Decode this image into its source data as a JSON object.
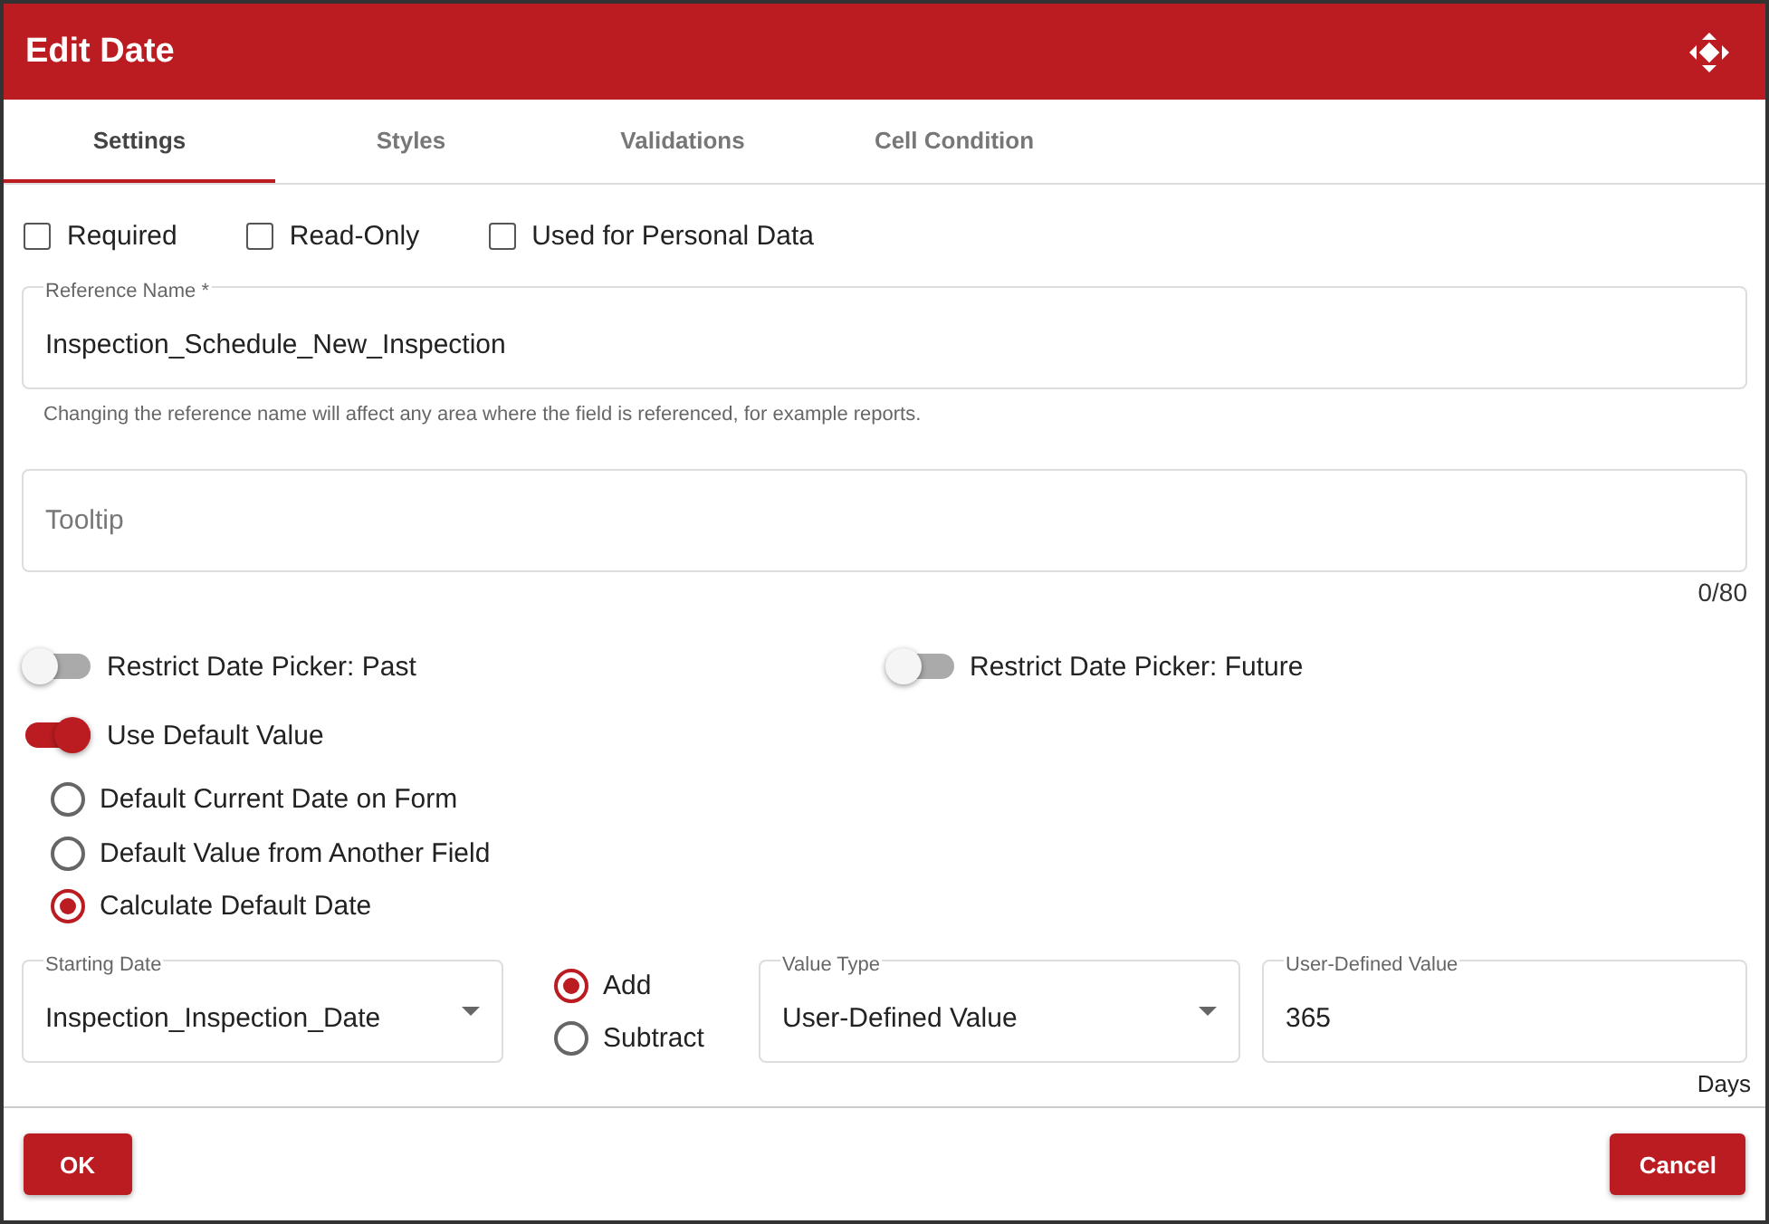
{
  "window": {
    "title": "Edit Date"
  },
  "tabs": [
    {
      "label": "Settings",
      "selected": true
    },
    {
      "label": "Styles",
      "selected": false
    },
    {
      "label": "Validations",
      "selected": false
    },
    {
      "label": "Cell Condition",
      "selected": false
    }
  ],
  "flags": [
    {
      "label": "Required",
      "checked": false
    },
    {
      "label": "Read-Only",
      "checked": false
    },
    {
      "label": "Used for Personal Data",
      "checked": false
    }
  ],
  "reference_name": {
    "label": "Reference Name *",
    "value": "Inspection_Schedule_New_Inspection",
    "helper": "Changing the reference name will affect any area where the field is referenced, for example reports."
  },
  "tooltip": {
    "placeholder": "Tooltip",
    "counter": "0/80"
  },
  "restrict_toggles": [
    {
      "label": "Restrict Date Picker: Past",
      "on": false
    },
    {
      "label": "Restrict Date Picker: Future",
      "on": false
    }
  ],
  "default_toggle": {
    "label": "Use Default Value",
    "on": true
  },
  "default_options": [
    {
      "label": "Default Current Date on Form",
      "selected": false
    },
    {
      "label": "Default Value from Another Field",
      "selected": false
    },
    {
      "label": "Calculate Default Date",
      "selected": true
    }
  ],
  "starting_date": {
    "label": "Starting Date",
    "value": "Inspection_Inspection_Date"
  },
  "operations": [
    {
      "label": "Add",
      "selected": true
    },
    {
      "label": "Subtract",
      "selected": false
    }
  ],
  "value_type": {
    "label": "Value Type",
    "value": "User-Defined Value"
  },
  "user_value": {
    "label": "User-Defined Value",
    "value": "365",
    "unit": "Days"
  },
  "buttons": {
    "ok": "OK",
    "cancel": "Cancel"
  }
}
